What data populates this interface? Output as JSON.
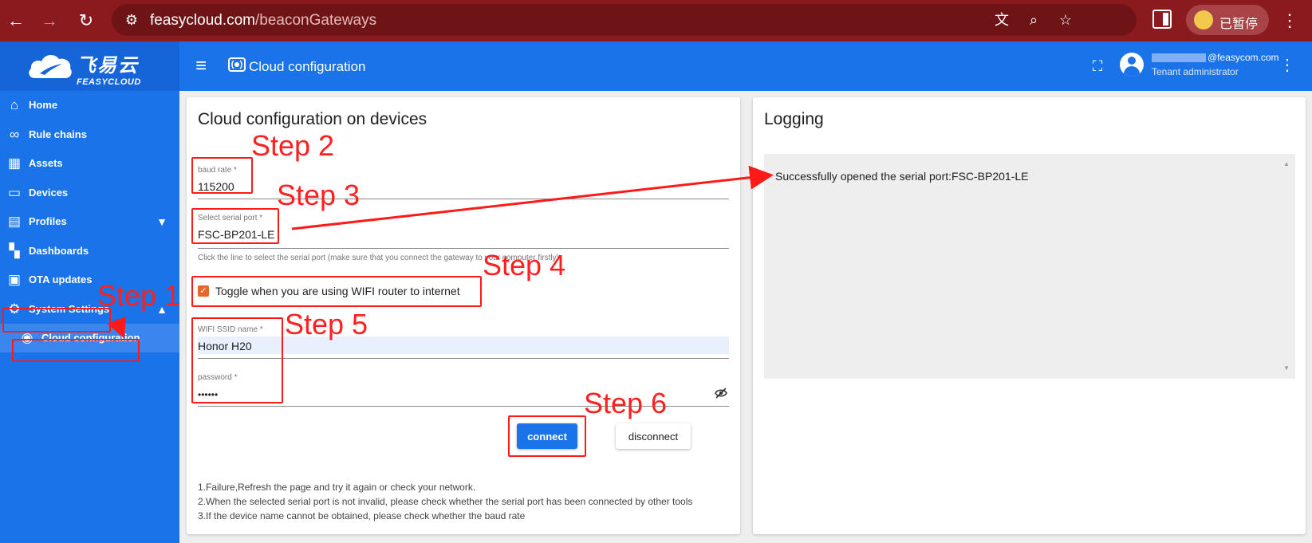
{
  "browser": {
    "url_host": "feasycloud.com",
    "url_path": "/beaconGateways",
    "paused_label": "已暂停"
  },
  "header": {
    "logo_cn": "飞易云",
    "logo_en": "FEASYCLOUD",
    "title": "Cloud configuration",
    "user_email": "@feasycom.com",
    "user_role": "Tenant administrator"
  },
  "sidebar": {
    "items": [
      {
        "label": "Home",
        "icon": "home-icon"
      },
      {
        "label": "Rule chains",
        "icon": "link-icon"
      },
      {
        "label": "Assets",
        "icon": "domain-icon"
      },
      {
        "label": "Devices",
        "icon": "devices-icon"
      },
      {
        "label": "Profiles",
        "icon": "badge-icon"
      },
      {
        "label": "Dashboards",
        "icon": "dashboard-icon"
      },
      {
        "label": "OTA updates",
        "icon": "memory-icon"
      },
      {
        "label": "System Settings",
        "icon": "gear-icon"
      },
      {
        "label": "Cloud configuration",
        "icon": "router-icon"
      }
    ]
  },
  "config": {
    "title": "Cloud configuration on devices",
    "baud_label": "baud rate *",
    "baud_value": "115200",
    "serial_label": "Select serial port *",
    "serial_value": "FSC-BP201-LE",
    "serial_hint": "Click the line to select the serial port (make sure that you connect the gateway to your computer firstly)",
    "wifi_toggle_label": "Toggle when you are using WIFI router to internet",
    "wifi_toggle_checked": true,
    "ssid_label": "WIFI SSID name *",
    "ssid_value": "Honor H20",
    "password_label": "password *",
    "password_value": "••••••",
    "connect_label": "connect",
    "disconnect_label": "disconnect",
    "notes": [
      "1.Failure,Refresh the page and try it again or check your network.",
      "2.When the selected serial port is not invalid, please check whether the serial port has been connected by other tools",
      "3.If the device name cannot be obtained, please check whether the baud rate"
    ]
  },
  "logging": {
    "title": "Logging",
    "message": "Successfully opened the serial port:FSC-BP201-LE"
  },
  "annotations": {
    "steps": [
      "Step 1",
      "Step 2",
      "Step 3",
      "Step 4",
      "Step 5",
      "Step 6"
    ],
    "color": "#ff1a1a"
  },
  "colors": {
    "primary": "#1a73e8",
    "browser_bar": "#8a1a1e",
    "checkbox": "#e8662b"
  }
}
